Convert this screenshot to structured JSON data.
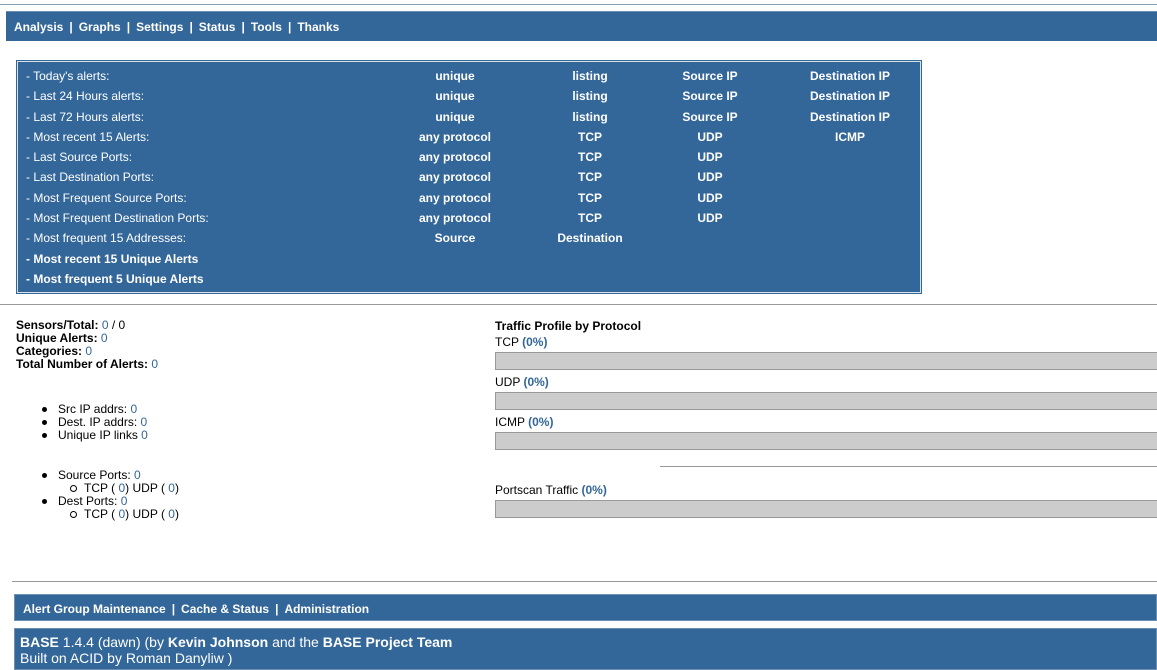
{
  "nav": {
    "items": [
      "Analysis",
      "Graphs",
      "Settings",
      "Status",
      "Tools",
      "Thanks"
    ]
  },
  "alerts": {
    "rows": [
      {
        "label": "- Today's alerts:",
        "c1": "unique",
        "c2": "listing",
        "c3": "Source IP",
        "c4": "Destination IP"
      },
      {
        "label": "- Last 24 Hours alerts:",
        "c1": "unique",
        "c2": "listing",
        "c3": "Source IP",
        "c4": "Destination IP"
      },
      {
        "label": "- Last 72 Hours alerts:",
        "c1": "unique",
        "c2": "listing",
        "c3": "Source IP",
        "c4": "Destination IP"
      },
      {
        "label": "- Most recent 15 Alerts:",
        "c1": "any protocol",
        "c2": "TCP",
        "c3": "UDP",
        "c4": "ICMP"
      },
      {
        "label": "- Last Source Ports:",
        "c1": "any protocol",
        "c2": "TCP",
        "c3": "UDP",
        "c4": ""
      },
      {
        "label": "- Last Destination Ports:",
        "c1": "any protocol",
        "c2": "TCP",
        "c3": "UDP",
        "c4": ""
      },
      {
        "label": "- Most Frequent Source Ports:",
        "c1": "any protocol",
        "c2": "TCP",
        "c3": "UDP",
        "c4": ""
      },
      {
        "label": "- Most Frequent Destination Ports:",
        "c1": "any protocol",
        "c2": "TCP",
        "c3": "UDP",
        "c4": ""
      },
      {
        "label": "- Most frequent 15 Addresses:",
        "c1": "Source",
        "c2": "Destination",
        "c3": "",
        "c4": ""
      }
    ],
    "bold_links": [
      "- Most recent 15 Unique Alerts",
      "- Most frequent 5 Unique Alerts"
    ]
  },
  "stats": {
    "sensors_label": "Sensors/Total:",
    "sensors_value": "0",
    "sensors_sep": " / ",
    "sensors_total": "0",
    "unique_alerts_label": "Unique Alerts:",
    "unique_alerts_value": "0",
    "categories_label": "Categories:",
    "categories_value": "0",
    "total_alerts_label": "Total Number of Alerts:",
    "total_alerts_value": "0",
    "src_ip_label": "Src IP addrs:",
    "src_ip_value": "0",
    "dest_ip_label": "Dest. IP addrs:",
    "dest_ip_value": "0",
    "unique_ip_label": "Unique IP links",
    "unique_ip_value": "0",
    "source_ports_label": "Source Ports:",
    "source_ports_value": "0",
    "source_tcp_label": "TCP (",
    "source_tcp_value": "0",
    "source_udp_label": ") UDP (",
    "source_udp_value": "0",
    "close_paren": ")",
    "dest_ports_label": "Dest Ports:",
    "dest_ports_value": "0",
    "dest_tcp_label": "TCP (",
    "dest_tcp_value": "0",
    "dest_udp_label": ") UDP (",
    "dest_udp_value": "0"
  },
  "traffic": {
    "title": "Traffic Profile by Protocol",
    "tcp_label": "TCP",
    "tcp_pct": "(0%)",
    "udp_label": "UDP",
    "udp_pct": "(0%)",
    "icmp_label": "ICMP",
    "icmp_pct": "(0%)",
    "portscan_label": "Portscan Traffic",
    "portscan_pct": "(0%)"
  },
  "footer_nav": {
    "items": [
      "Alert Group Maintenance",
      "Cache & Status",
      "Administration"
    ]
  },
  "credits": {
    "base": "BASE",
    "version": " 1.4.4 (dawn) (by ",
    "author": "Kevin Johnson",
    "and": " and the ",
    "team": "BASE Project Team",
    "line2": "Built on ACID by Roman Danyliw )"
  },
  "colors": {
    "header_bg": "#336699",
    "value_link": "#336699",
    "bar_fill": "#cccccc"
  }
}
